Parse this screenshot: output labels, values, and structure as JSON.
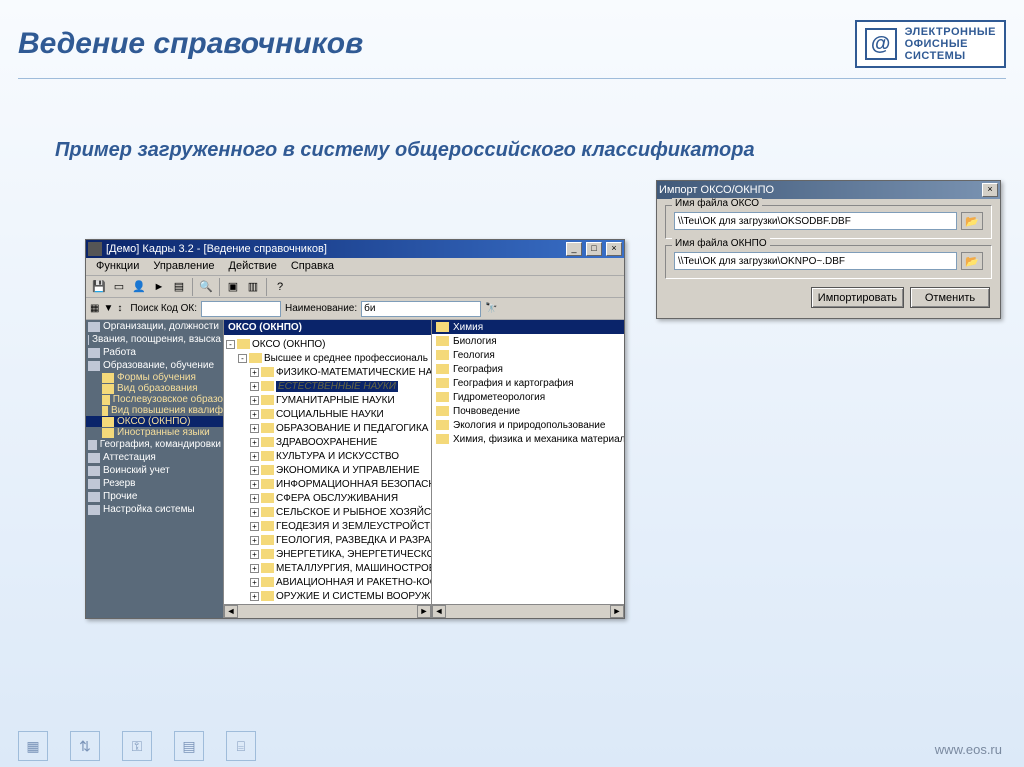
{
  "slide": {
    "title": "Ведение справочников",
    "subtitle": "Пример загруженного в систему общероссийского классификатора",
    "footer_url": "www.eos.ru",
    "brand_line1": "ЭЛЕКТРОННЫЕ",
    "brand_line2": "ОФИСНЫЕ",
    "brand_line3": "СИСТЕМЫ"
  },
  "app": {
    "title": "[Демо] Кадры 3.2 - [Ведение справочников]",
    "menus": [
      "Функции",
      "Управление",
      "Действие",
      "Справка"
    ],
    "search": {
      "label": "Поиск Код ОК:",
      "code_value": "",
      "name_label": "Наименование:",
      "name_value": "би"
    },
    "leftnav": [
      {
        "type": "cat",
        "label": "Организации, должности",
        "icon": "org"
      },
      {
        "type": "cat",
        "label": "Звания, поощрения, взыска",
        "icon": "star"
      },
      {
        "type": "cat",
        "label": "Работа",
        "icon": "work"
      },
      {
        "type": "cat",
        "label": "Образование, обучение",
        "icon": "edu"
      },
      {
        "type": "child",
        "label": "Формы обучения"
      },
      {
        "type": "child",
        "label": "Вид образования"
      },
      {
        "type": "child",
        "label": "Послевузовское образо"
      },
      {
        "type": "child",
        "label": "Вид повышения квалиф"
      },
      {
        "type": "child",
        "label": "ОКСО (ОКНПО)",
        "selected": true
      },
      {
        "type": "child",
        "label": "Иностранные языки"
      },
      {
        "type": "cat",
        "label": "География, командировки",
        "icon": "geo"
      },
      {
        "type": "cat",
        "label": "Аттестация",
        "icon": "att"
      },
      {
        "type": "cat",
        "label": "Воинский учет",
        "icon": "mil"
      },
      {
        "type": "cat",
        "label": "Резерв",
        "icon": "res"
      },
      {
        "type": "cat",
        "label": "Прочие",
        "icon": "oth"
      },
      {
        "type": "cat",
        "label": "Настройка системы",
        "icon": "set"
      }
    ],
    "midheader": "ОКСО (ОКНПО)",
    "tree": [
      {
        "lvl": 0,
        "toggle": "-",
        "label": "ОКСО (ОКНПО)"
      },
      {
        "lvl": 1,
        "toggle": "-",
        "label": "Высшее и среднее профессиональ"
      },
      {
        "lvl": 2,
        "toggle": "+",
        "label": "ФИЗИКО-МАТЕМАТИЧЕСКИЕ НАУ"
      },
      {
        "lvl": 2,
        "toggle": "+",
        "label": "ЕСТЕСТВЕННЫЕ НАУКИ",
        "selected": true,
        "italic": true
      },
      {
        "lvl": 2,
        "toggle": "+",
        "label": "ГУМАНИТАРНЫЕ НАУКИ"
      },
      {
        "lvl": 2,
        "toggle": "+",
        "label": "СОЦИАЛЬНЫЕ НАУКИ"
      },
      {
        "lvl": 2,
        "toggle": "+",
        "label": "ОБРАЗОВАНИЕ И ПЕДАГОГИКА"
      },
      {
        "lvl": 2,
        "toggle": "+",
        "label": "ЗДРАВООХРАНЕНИЕ"
      },
      {
        "lvl": 2,
        "toggle": "+",
        "label": "КУЛЬТУРА И ИСКУССТВО"
      },
      {
        "lvl": 2,
        "toggle": "+",
        "label": "ЭКОНОМИКА И УПРАВЛЕНИЕ"
      },
      {
        "lvl": 2,
        "toggle": "+",
        "label": "ИНФОРМАЦИОННАЯ БЕЗОПАСНО"
      },
      {
        "lvl": 2,
        "toggle": "+",
        "label": "СФЕРА ОБСЛУЖИВАНИЯ"
      },
      {
        "lvl": 2,
        "toggle": "+",
        "label": "СЕЛЬСКОЕ И РЫБНОЕ ХОЗЯЙСТ"
      },
      {
        "lvl": 2,
        "toggle": "+",
        "label": "ГЕОДЕЗИЯ И ЗЕМЛЕУСТРОЙСТВ"
      },
      {
        "lvl": 2,
        "toggle": "+",
        "label": "ГЕОЛОГИЯ, РАЗВЕДКА И РАЗРА"
      },
      {
        "lvl": 2,
        "toggle": "+",
        "label": "ЭНЕРГЕТИКА, ЭНЕРГЕТИЧЕСКО"
      },
      {
        "lvl": 2,
        "toggle": "+",
        "label": "МЕТАЛЛУРГИЯ, МАШИНОСТРОЕ"
      },
      {
        "lvl": 2,
        "toggle": "+",
        "label": "АВИАЦИОННАЯ И РАКЕТНО-КОС"
      },
      {
        "lvl": 2,
        "toggle": "+",
        "label": "ОРУЖИЕ И СИСТЕМЫ ВООРУЖЕ"
      }
    ],
    "rightlist": [
      {
        "label": "Химия",
        "selected": true
      },
      {
        "label": "Биология"
      },
      {
        "label": "Геология"
      },
      {
        "label": "География"
      },
      {
        "label": "География и картография"
      },
      {
        "label": "Гидрометеорология"
      },
      {
        "label": "Почвоведение"
      },
      {
        "label": "Экология и природопользование"
      },
      {
        "label": "Химия, физика и механика материало"
      }
    ]
  },
  "dialog": {
    "title": "Импорт  ОКСО/ОКНПО",
    "group1": "Имя файла ОКСО",
    "path1": "\\\\Teu\\ОК для загрузки\\OKSODBF.DBF",
    "group2": "Имя файла ОКНПО",
    "path2": "\\\\Teu\\ОК для загрузки\\OKNPO~.DBF",
    "btn_import": "Импортировать",
    "btn_cancel": "Отменить"
  }
}
